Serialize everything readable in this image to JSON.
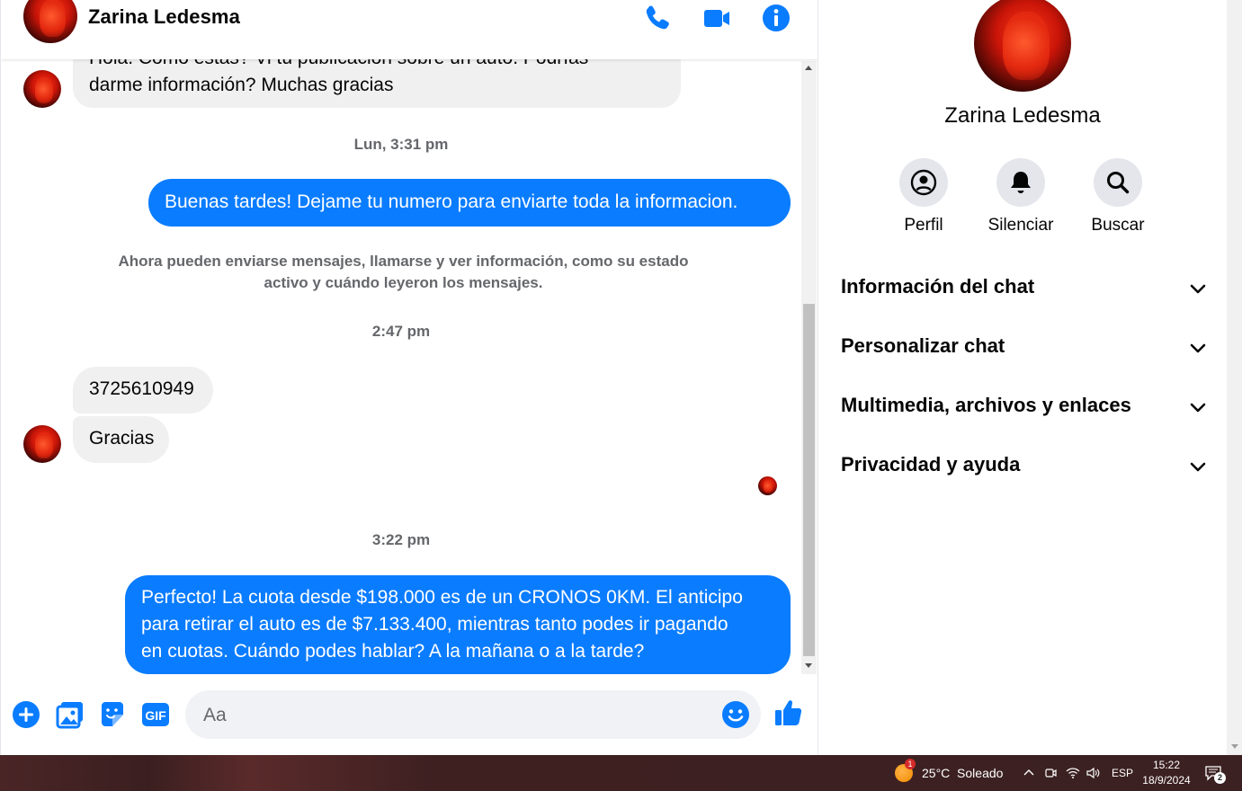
{
  "contact": {
    "name": "Zarina Ledesma"
  },
  "header": {
    "call_icon": "phone-icon",
    "video_icon": "video-camera-icon",
    "info_icon": "info-icon"
  },
  "messages": {
    "m1": {
      "line1": "Hola. Como estás? Vi tu publicación sobre un auto. Podrías",
      "line2": "darme información? Muchas gracias"
    },
    "t1": "Lun, 3:31 pm",
    "m2": "Buenas tardes! Dejame tu numero para enviarte toda la informacion.",
    "note_line1": "Ahora pueden enviarse mensajes, llamarse y ver información, como su estado",
    "note_line2": "activo y cuándo leyeron los mensajes.",
    "t2": "2:47 pm",
    "m3": "3725610949",
    "m4": "Gracias",
    "t3": "3:22 pm",
    "m5": {
      "line1": "Perfecto! La cuota desde $198.000 es de un CRONOS 0KM. El anticipo",
      "line2": "para retirar el auto es de $7.133.400, mientras tanto podes ir pagando",
      "line3": "en cuotas. Cuándo podes hablar? A la mañana o a la tarde?"
    }
  },
  "composer": {
    "placeholder": "Aa",
    "icons": [
      "plus-icon",
      "image-icon",
      "sticker-icon",
      "gif-icon",
      "emoji-icon",
      "thumbs-up-icon"
    ],
    "gif_label": "GIF"
  },
  "info_panel": {
    "name": "Zarina Ledesma",
    "actions": [
      {
        "label": "Perfil",
        "icon": "profile-icon"
      },
      {
        "label": "Silenciar",
        "icon": "bell-icon"
      },
      {
        "label": "Buscar",
        "icon": "search-icon"
      }
    ],
    "sections": [
      "Información del chat",
      "Personalizar chat",
      "Multimedia, archivos y enlaces",
      "Privacidad y ayuda"
    ]
  },
  "taskbar": {
    "weather": "25°C  Soleado",
    "weather_badge": "1",
    "language": "ESP",
    "time": "15:22",
    "date": "18/9/2024",
    "notifications": "2"
  },
  "colors": {
    "accent": "#0a7cff",
    "incoming_bubble": "#f0f0f0",
    "meta_text": "#65676b"
  }
}
